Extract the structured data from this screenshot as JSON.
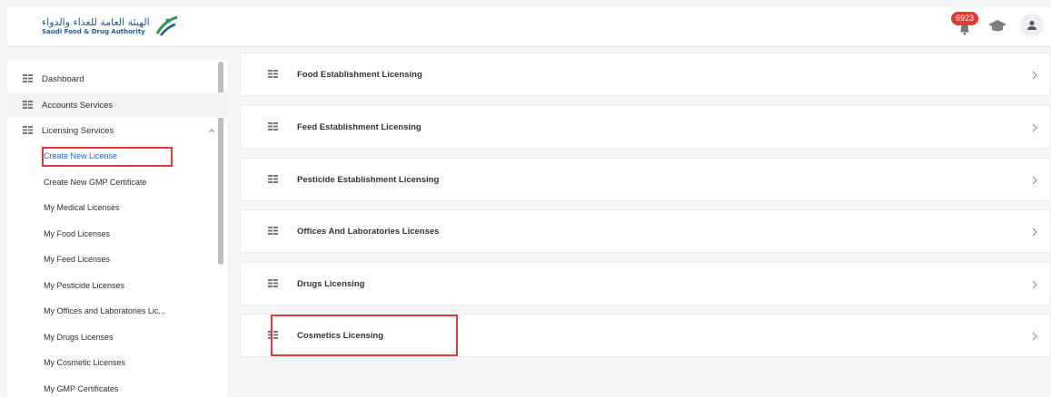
{
  "header": {
    "logo_arabic": "الهيئة العامة للغذاء والدواء",
    "logo_english": "Saudi Food & Drug Authority",
    "notification_count": "6923"
  },
  "sidebar": {
    "top_items": [
      {
        "label": "Dashboard"
      },
      {
        "label": "Accounts Services"
      },
      {
        "label": "Licensing Services"
      }
    ],
    "sub_items": [
      {
        "label": "Create New License"
      },
      {
        "label": "Create New GMP Certificate"
      },
      {
        "label": "My Medical Licenses"
      },
      {
        "label": "My Food Licenses"
      },
      {
        "label": "My Feed Licenses"
      },
      {
        "label": "My Pesticide Licenses"
      },
      {
        "label": "My Offices and Laboratories Lic..."
      },
      {
        "label": "My Drugs Licenses"
      },
      {
        "label": "My Cosmetic Licenses"
      },
      {
        "label": "My GMP Certificates"
      }
    ]
  },
  "main": {
    "cards": [
      {
        "label": "Food Establishment Licensing"
      },
      {
        "label": "Feed Establishment Licensing"
      },
      {
        "label": "Pesticide Establishment Licensing"
      },
      {
        "label": "Offices And Laboratories Licenses"
      },
      {
        "label": "Drugs Licensing"
      },
      {
        "label": "Cosmetics Licensing"
      }
    ]
  },
  "colors": {
    "accent_link": "#1f6dbf",
    "highlight_box": "#e53935",
    "badge": "#e53935"
  }
}
